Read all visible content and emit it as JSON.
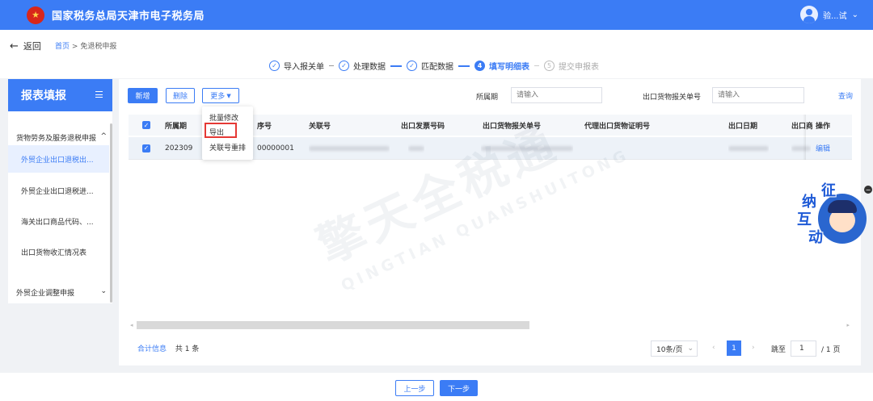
{
  "header": {
    "title": "国家税务总局天津市电子税务局",
    "user_name": "验...试"
  },
  "nav": {
    "back_label": "返回",
    "breadcrumb_home": "首页",
    "breadcrumb_sep": ">",
    "breadcrumb_current": "免退税申报"
  },
  "steps": [
    {
      "num": "✓",
      "label": "导入报关单",
      "state": "done"
    },
    {
      "num": "✓",
      "label": "处理数据",
      "state": "done"
    },
    {
      "num": "✓",
      "label": "匹配数据",
      "state": "done"
    },
    {
      "num": "4",
      "label": "填写明细表",
      "state": "active"
    },
    {
      "num": "5",
      "label": "提交申报表",
      "state": "pending"
    }
  ],
  "sidebar": {
    "title": "报表填报",
    "group1": "货物劳务及服务退税申报",
    "items": [
      "外贸企业出口退税出...",
      "外贸企业出口退税进...",
      "海关出口商品代码、...",
      "出口货物收汇情况表"
    ],
    "group2": "外贸企业调整申报"
  },
  "toolbar": {
    "add": "新增",
    "delete": "删除",
    "more": "更多",
    "period_label": "所属期",
    "period_placeholder": "请输入",
    "customs_label": "出口货物报关单号",
    "customs_placeholder": "请输入",
    "query": "查询"
  },
  "dropdown": [
    "批量修改",
    "导出",
    "关联号重排"
  ],
  "table": {
    "headers": [
      "所属期",
      "序号",
      "关联号",
      "出口发票号码",
      "出口货物报关单号",
      "代理出口货物证明号",
      "出口日期",
      "出口商",
      "操作"
    ],
    "row": {
      "period": "202309",
      "seq": "00000001",
      "action": "编辑"
    }
  },
  "footer_info": {
    "summary_link": "合计信息",
    "count": "共 1 条"
  },
  "pager": {
    "page_size": "10条/页",
    "current": "1",
    "jump_label": "跳至",
    "jump_value": "1",
    "total": "/ 1 页"
  },
  "footer": {
    "prev": "上一步",
    "next": "下一步"
  },
  "mascot": {
    "chars": [
      "征",
      "纳",
      "互",
      "动"
    ]
  },
  "watermark": {
    "main": "擎天全税通",
    "sub": "QINGTIAN QUANSHUITONG"
  },
  "colors": {
    "primary": "#3b7cf5",
    "highlight": "#e53935"
  }
}
